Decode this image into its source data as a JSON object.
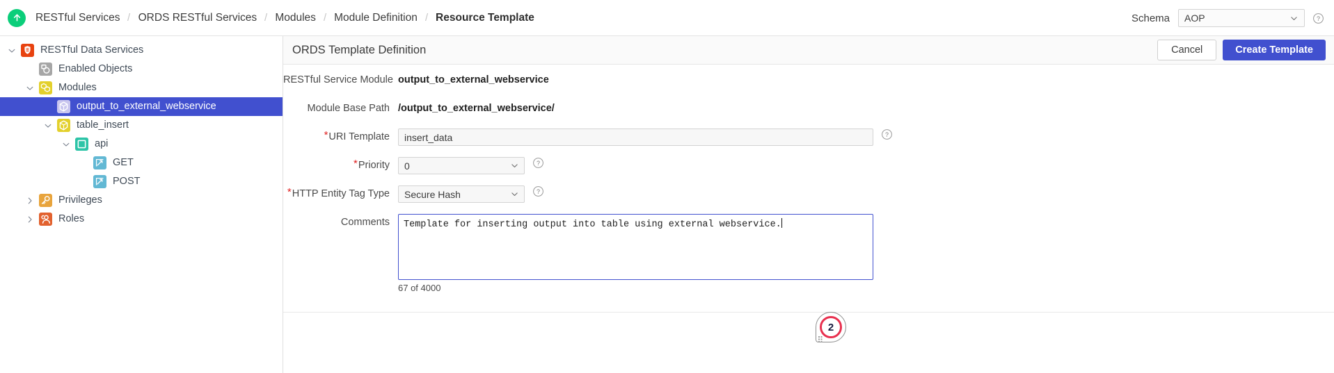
{
  "topbar": {
    "home_icon": "up-arrow-circle-icon",
    "breadcrumb": [
      {
        "label": "RESTful Services",
        "current": false
      },
      {
        "label": "ORDS RESTful Services",
        "current": false
      },
      {
        "label": "Modules",
        "current": false
      },
      {
        "label": "Module Definition",
        "current": false
      },
      {
        "label": "Resource Template",
        "current": true
      }
    ],
    "separator": "\\",
    "schema_label": "Schema",
    "schema_value": "AOP",
    "schema_chevron_icon": "chevron-down-icon",
    "help_icon": "help-circle-icon"
  },
  "tree": {
    "items": [
      {
        "label": "RESTful Data Services",
        "indent": 0,
        "twist": "expanded",
        "icon": "restful-data-services-icon",
        "icon_color": "#e8420f",
        "selected": false
      },
      {
        "label": "Enabled Objects",
        "indent": 1,
        "twist": "none",
        "icon": "enabled-objects-icon",
        "icon_color": "#a6a6a6",
        "selected": false
      },
      {
        "label": "Modules",
        "indent": 1,
        "twist": "expanded",
        "icon": "modules-icon",
        "icon_color": "#e3d02c",
        "selected": false
      },
      {
        "label": "output_to_external_webservice",
        "indent": 2,
        "twist": "none",
        "icon": "module-cube-icon",
        "icon_color": "#c9c6ef",
        "selected": true
      },
      {
        "label": "table_insert",
        "indent": 2,
        "twist": "expanded",
        "icon": "module-cube-icon",
        "icon_color": "#e3d02c",
        "selected": false
      },
      {
        "label": "api",
        "indent": 3,
        "twist": "expanded",
        "icon": "resource-template-icon",
        "icon_color": "#2dc4a7",
        "selected": false
      },
      {
        "label": "GET",
        "indent": 4,
        "twist": "none",
        "icon": "handler-icon",
        "icon_color": "#62b8d4",
        "selected": false
      },
      {
        "label": "POST",
        "indent": 4,
        "twist": "none",
        "icon": "handler-icon",
        "icon_color": "#62b8d4",
        "selected": false
      },
      {
        "label": "Privileges",
        "indent": 1,
        "twist": "collapsed",
        "icon": "key-icon",
        "icon_color": "#e8a43c",
        "selected": false
      },
      {
        "label": "Roles",
        "indent": 1,
        "twist": "collapsed",
        "icon": "roles-icon",
        "icon_color": "#e2622f",
        "selected": false
      }
    ]
  },
  "panel": {
    "title": "ORDS Template Definition",
    "cancel_label": "Cancel",
    "create_label": "Create Template"
  },
  "form": {
    "module_label": "RESTful Service Module",
    "module_value": "output_to_external_webservice",
    "base_path_label": "Module Base Path",
    "base_path_value": "/output_to_external_webservice/",
    "uri_label": "URI Template",
    "uri_value": "insert_data",
    "uri_required": "*",
    "priority_label": "Priority",
    "priority_value": "0",
    "priority_required": "*",
    "etag_label": "HTTP Entity Tag Type",
    "etag_value": "Secure Hash",
    "etag_required": "*",
    "comments_label": "Comments",
    "comments_value": "Template for inserting output into table using external webservice.",
    "char_count": "67 of 4000"
  },
  "annotation": {
    "number": "2"
  }
}
